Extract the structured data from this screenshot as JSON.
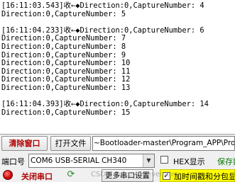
{
  "terminal": {
    "lines": [
      "[16:11:03.543]收←◆Direction:0,CaptureNumber: 4",
      "Direction:0,CaptureNumber: 5",
      "",
      "[16:11:04.233]收←◆Direction:0,CaptureNumber: 6",
      "Direction:0,CaptureNumber: 7",
      "Direction:0,CaptureNumber: 8",
      "Direction:0,CaptureNumber: 9",
      "Direction:0,CaptureNumber: 10",
      "Direction:0,CaptureNumber: 11",
      "Direction:0,CaptureNumber: 12",
      "Direction:0,CaptureNumber: 13",
      "",
      "[16:11:04.393]收←◆Direction:0,CaptureNumber: 14",
      "Direction:0,CaptureNumber: 15"
    ]
  },
  "toolbar": {
    "clear_label": "清除窗口",
    "open_file_label": "打开文件",
    "file_path": "~Bootloader-master\\Program_APP\\Program"
  },
  "port": {
    "label": "端口号",
    "selected": "COM6 USB-SERIAL CH340",
    "hex_display_label": "HEX显示",
    "save_data_label": "保存数据"
  },
  "bottom": {
    "close_port_label": "关闭串口",
    "more_settings_label": "更多串口设置",
    "timestamp_label": "加时间戳和分包显示",
    "watermark": "CSDN @erevsereveinder"
  },
  "colors": {
    "clear_text": "#b00000",
    "timestamp_bg": "#ffff00",
    "status_dot": "#d00000"
  }
}
